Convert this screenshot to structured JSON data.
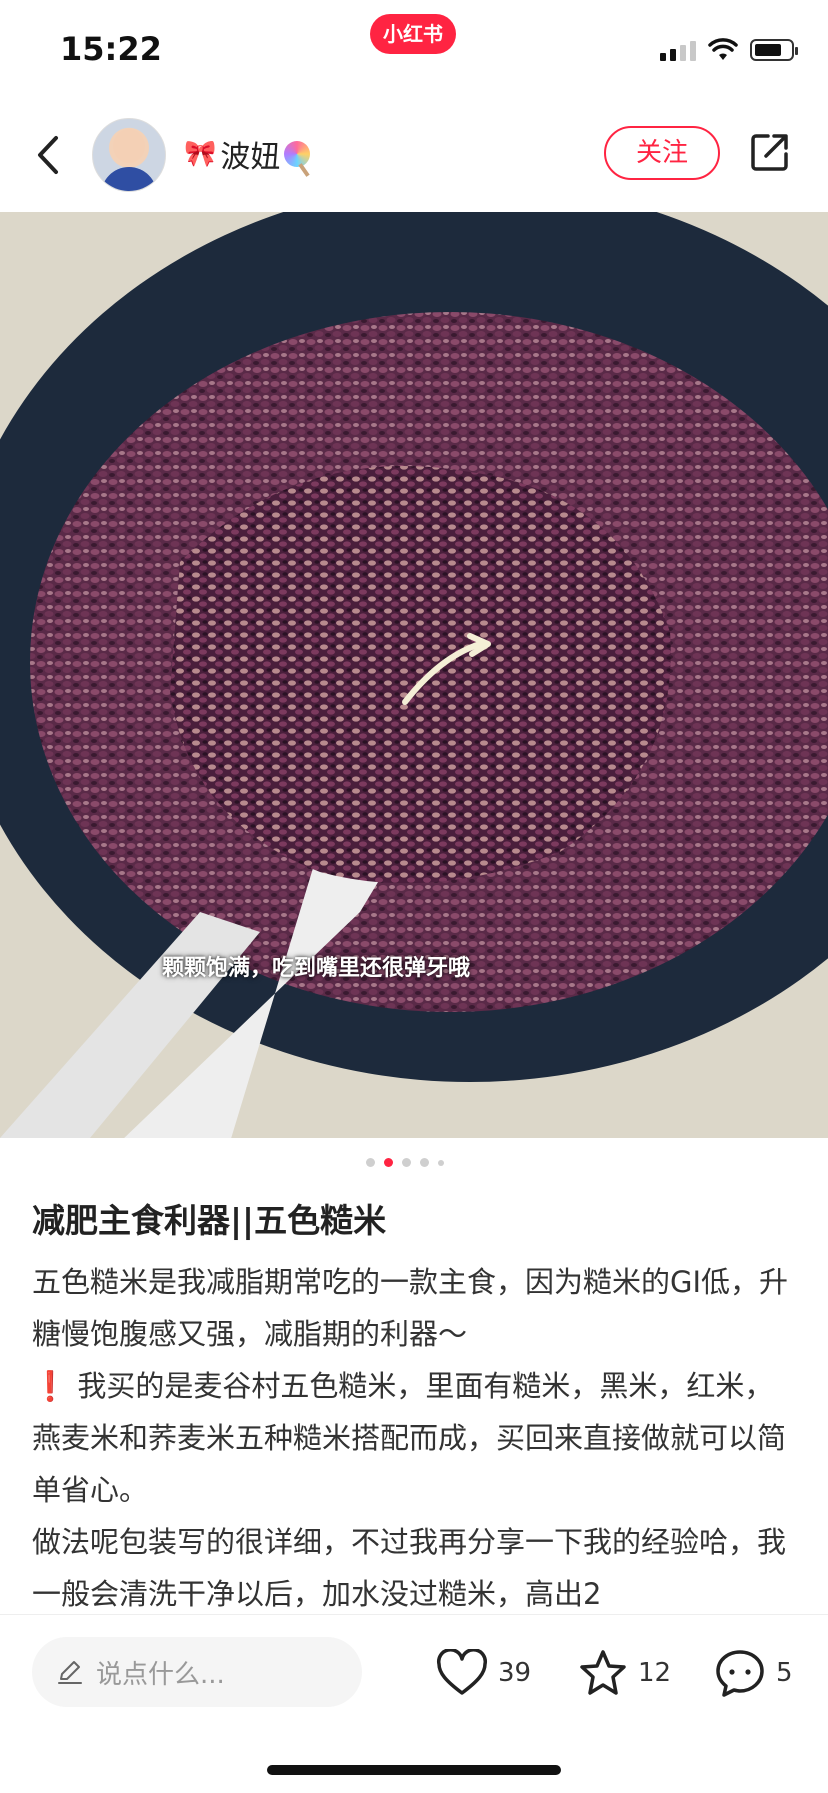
{
  "status_bar": {
    "time": "15:22",
    "app_badge": "小红书"
  },
  "header": {
    "author_name": "波妞",
    "follow_label": "关注"
  },
  "photo": {
    "caption": "颗颗饱满，吃到嘴里还很弹牙哦"
  },
  "carousel": {
    "count": 5,
    "active_index": 1
  },
  "post": {
    "title": "减肥主食利器||五色糙米",
    "paragraphs": [
      "五色糙米是我减脂期常吃的一款主食，因为糙米的GI低，升糖慢饱腹感又强，减脂期的利器～",
      "我买的是麦谷村五色糙米，里面有糙米，黑米，红米，燕麦米和荞麦米五种糙米搭配而成，买回来直接做就可以简单省心。",
      "做法呢包装写的很详细，不过我再分享一下我的经验哈，我一般会清洗干净以后，加水没过糙米，高出2"
    ],
    "warning_icon": "❗"
  },
  "bottom_bar": {
    "comment_placeholder": "说点什么...",
    "likes": "39",
    "favorites": "12",
    "comments": "5"
  }
}
